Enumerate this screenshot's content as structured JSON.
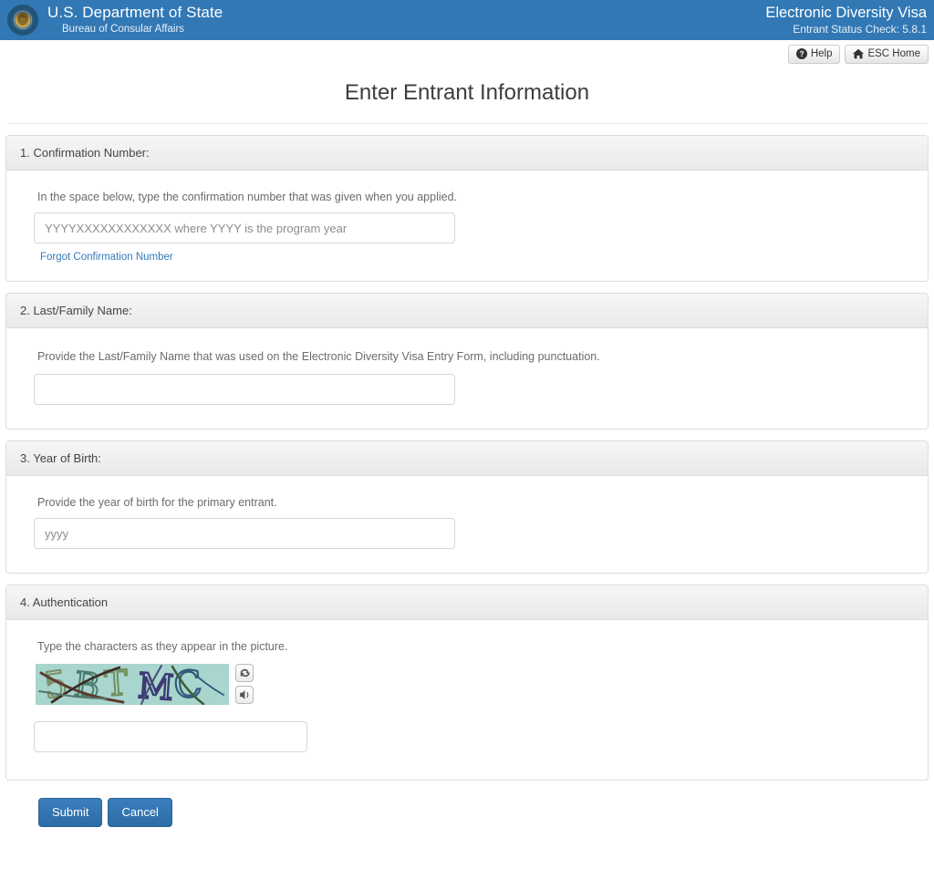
{
  "header": {
    "seal_icon": "us-department-of-state-seal-icon",
    "department": "U.S. Department of State",
    "bureau": "Bureau of Consular Affairs",
    "app_title": "Electronic Diversity Visa",
    "app_version": "Entrant Status Check: 5.8.1",
    "bar_color": "#3178b5"
  },
  "utility_bar": {
    "help_label": "Help",
    "help_icon": "question-circle-icon",
    "home_label": "ESC Home",
    "home_icon": "home-icon"
  },
  "page": {
    "title": "Enter Entrant Information"
  },
  "sections": {
    "confirmation": {
      "heading": "1. Confirmation Number:",
      "help": "In the space below, type the confirmation number that was given when you applied.",
      "input_value": "",
      "input_placeholder": "YYYYXXXXXXXXXXXX where YYYY is the program year",
      "link_label": "Forgot Confirmation Number",
      "link_color": "#337ab7"
    },
    "last_name": {
      "heading": "2. Last/Family Name:",
      "help": "Provide the Last/Family Name that was used on the Electronic Diversity Visa Entry Form, including punctuation.",
      "input_value": "",
      "input_placeholder": ""
    },
    "year_of_birth": {
      "heading": "3. Year of Birth:",
      "help": "Provide the year of birth for the primary entrant.",
      "input_value": "",
      "input_placeholder": "yyyy"
    },
    "authentication": {
      "heading": "4. Authentication",
      "help": "Type the characters as they appear in the picture.",
      "captcha_text": "5BTMC",
      "captcha_background": "#a8d5cd",
      "refresh_icon": "refresh-icon",
      "audio_icon": "speaker-audio-icon",
      "input_value": "",
      "input_placeholder": ""
    }
  },
  "actions": {
    "submit_label": "Submit",
    "cancel_label": "Cancel",
    "primary_color": "#2c6ca6"
  }
}
